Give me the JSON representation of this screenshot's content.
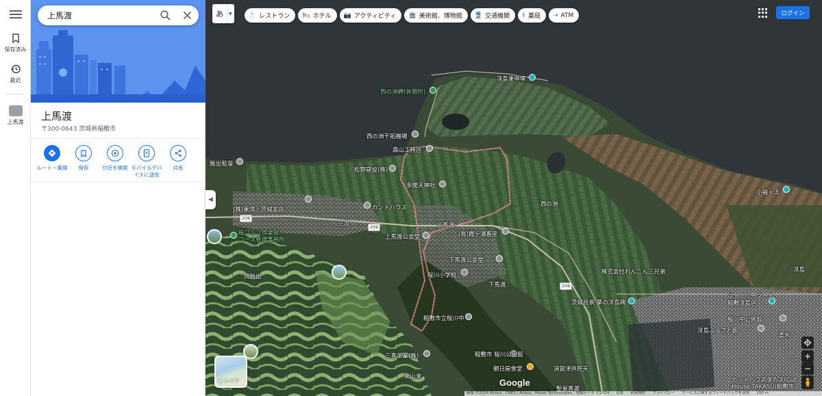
{
  "rail": {
    "saved_label": "保存済み",
    "recent_label": "最近",
    "place_label": "上馬渡"
  },
  "search": {
    "value": "上馬渡"
  },
  "place": {
    "title": "上馬渡",
    "address": "〒300-0643 茨城県稲敷市"
  },
  "actions": [
    {
      "label": "ルート・乗換"
    },
    {
      "label": "保存"
    },
    {
      "label": "付近を検索"
    },
    {
      "label": "モバイルデバイスに送信"
    },
    {
      "label": "共有"
    }
  ],
  "ime": {
    "char": "あ"
  },
  "chips": [
    {
      "icon": "fork-knife-icon",
      "glyph": "🍴",
      "label": "レストラン"
    },
    {
      "icon": "bed-icon",
      "glyph": "🛏",
      "label": "ホテル"
    },
    {
      "icon": "camera-icon",
      "glyph": "📷",
      "label": "アクティビティ"
    },
    {
      "icon": "museum-icon",
      "glyph": "🏛",
      "label": "美術館、博物館"
    },
    {
      "icon": "train-icon",
      "glyph": "🚆",
      "label": "交通機関"
    },
    {
      "icon": "pharmacy-icon",
      "glyph": "⚕",
      "label": "薬局"
    },
    {
      "icon": "atm-icon",
      "glyph": "⇢",
      "label": "ATM"
    }
  ],
  "login_label": "ログイン",
  "layers_label": "レイヤ",
  "google_logo": "Google",
  "attribution": {
    "imagery": "画像 ©2024 Airbus、CNES / Airbus、Maxar Technologies、地図データ ©2024",
    "country": "日本",
    "terms": "利用規約",
    "privacy": "プライバシー",
    "feedback": "サービスに関するフィードバックを送信",
    "scale": "200 m"
  },
  "map_labels": [
    {
      "text": "浮島東申塚",
      "style": "white"
    },
    {
      "text": "西の洲岬(休憩所)",
      "style": "green"
    },
    {
      "text": "西の洲干拓機場",
      "style": "white"
    },
    {
      "text": "森山工務店",
      "style": "white"
    },
    {
      "text": "飯出船溜",
      "style": "white"
    },
    {
      "text": "松野建設(株)",
      "style": "white"
    },
    {
      "text": "多聞天神社",
      "style": "white"
    },
    {
      "text": "(株)東洋・茨城支店",
      "style": "white"
    },
    {
      "text": "カントハウス",
      "style": "white"
    },
    {
      "text": "西の洲",
      "style": "white"
    },
    {
      "text": "小袖ヶ浜",
      "style": "white"
    },
    {
      "text": "上馬渡",
      "style": "white"
    },
    {
      "text": "三次",
      "style": "white"
    },
    {
      "text": "(有)霞ヶ浦畜産",
      "style": "white"
    },
    {
      "text": "上馬渡公会堂",
      "style": "white"
    },
    {
      "text": "桜ゴルフ倶楽部\nコース管理事務所",
      "style": "green"
    },
    {
      "text": "下馬渡公会堂",
      "style": "white"
    },
    {
      "text": "株式会社れんこん三兄弟",
      "style": "white"
    },
    {
      "text": "浮島",
      "style": "white"
    },
    {
      "text": "岡飯出",
      "style": "white"
    },
    {
      "text": "桜川小学校",
      "style": "white"
    },
    {
      "text": "下馬渡",
      "style": "white"
    },
    {
      "text": "ファミリーマート\n稲敷浮島店",
      "style": "white"
    },
    {
      "text": "茨城百景 夢の浮島碑",
      "style": "white"
    },
    {
      "text": "稲敷市立桜川中",
      "style": "white"
    },
    {
      "text": "桜川中公民館",
      "style": "white"
    },
    {
      "text": "浮島ふるさと館",
      "style": "white"
    },
    {
      "text": "稲敷市 桜川公民館",
      "style": "white"
    },
    {
      "text": "三喜工業(株)",
      "style": "white"
    },
    {
      "text": "朝日屋食堂",
      "style": "white"
    },
    {
      "text": "須賀津井肝天",
      "style": "white"
    },
    {
      "text": "南山来",
      "style": "white"
    },
    {
      "text": "聖泉香選",
      "style": "white"
    },
    {
      "text": "カットハウスタカス(Cut House TAKASU)稲敷市",
      "style": "white"
    },
    {
      "text": "清水",
      "style": "white"
    }
  ],
  "road_number": "206"
}
